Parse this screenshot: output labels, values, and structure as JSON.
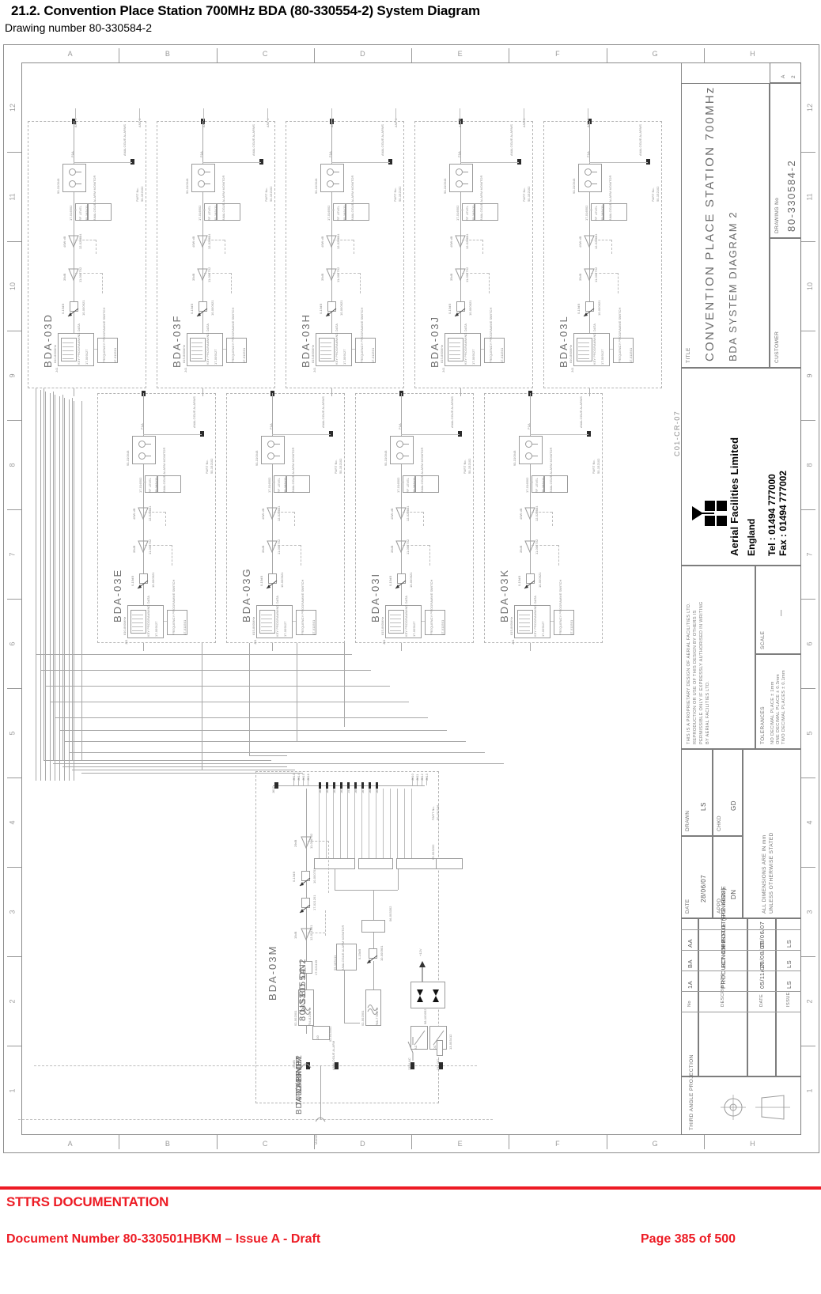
{
  "heading": {
    "title": "21.2. Convention Place Station 700MHz BDA (80-330554-2) System Diagram",
    "subtitle": "Drawing number 80-330584-2"
  },
  "footer": {
    "rule_color": "#ed1b24",
    "line1": "STTRS DOCUMENTATION",
    "line2": "Document Number 80-330501HBKM – Issue A - Draft",
    "line3": "Page 385 of 500"
  },
  "sheet": {
    "border_letters": [
      "A",
      "B",
      "C",
      "D",
      "E",
      "F",
      "G",
      "H"
    ],
    "border_numbers": [
      "12",
      "11",
      "10",
      "9",
      "8",
      "7",
      "6",
      "5",
      "4",
      "3",
      "2",
      "1"
    ],
    "sheet_ref": "C01-CR-07",
    "used_on_label": "USED ON",
    "used_on_value": "80-330554-2",
    "to_from_label": "TO/FROM",
    "to_from_value_1": "700/800MHz",
    "to_from_value_2": "BDA CABINET"
  },
  "titleblock": {
    "title_label": "TITLE",
    "title_line1": "CONVENTION PLACE STATION 700MHz",
    "title_line2": "BDA SYSTEM DIAGRAM 2",
    "drawing_no_label": "DRAWING No",
    "drawing_no": "80-330584-2",
    "customer_label": "CUSTOMER",
    "customer": "",
    "sheet_a": "A",
    "sheet_2": "2",
    "company_name": "Aerial Facilities Limited",
    "company_country": "England",
    "company_tel": "Tel : 01494 777000",
    "company_fax": "Fax : 01494 777002",
    "proprietary_notice": "THIS IS A PROPRIETARY DESIGN OF AERIAL FACILITIES LTD. REPRODUCTION OR USE OF THIS DESIGN BY OTHERS IS PERMISSIBLE ONLY IF EXPRESSLY AUTHORISED IN WRITING BY AERIAL FACILITIES LTD.",
    "scale_label": "SCALE",
    "scale_value": "—",
    "tolerances_label": "TOLERANCES",
    "tolerance_lines": [
      "NO DECIMAL PLACE ± 1mm",
      "ONE DECIMAL PLACE ± 0.3mm",
      "TWO DECIMAL PLACES ± 0.1mm"
    ],
    "dimensions_note": "ALL DIMENSIONS ARE IN mm UNLESS OTHERWISE STATED",
    "drawn_label": "DRAWN",
    "drawn_by": "LS",
    "date_label": "DATE",
    "drawn_date": "28/06/07",
    "chkd_label": "CHKD",
    "chkd_by": "GD",
    "appd_label": "APPD",
    "appd_by": "DN",
    "third_angle_label": "THIRD ANGLE PROJECTION",
    "revision_headers": {
      "no": "No",
      "description": "DESCRIPTION",
      "date": "DATE",
      "issue": "ISSUE"
    },
    "revisions": [
      {
        "no": "1A",
        "description": "PRODUCTION ISSUE (ECN4628)",
        "date": "05/11/07",
        "issue": "LS"
      },
      {
        "no": "BA",
        "description": "ECN4552",
        "date": "28/08/07",
        "issue": "LS"
      },
      {
        "no": "AA",
        "description": "PROTOTYPE ISSUE",
        "date": "28/06/07",
        "issue": "LS"
      }
    ]
  },
  "schematic": {
    "modules_row1": [
      "BDA-03D",
      "BDA-03F",
      "BDA-03H",
      "BDA-03J",
      "BDA-03L"
    ],
    "modules_row2": [
      "BDA-03E",
      "BDA-03G",
      "BDA-03I",
      "BDA-03K"
    ],
    "module_main": "BDA-03M",
    "antenna_ports_row1": [
      "ANT 1",
      "ANT 2",
      "ANT 3",
      "ANT 4",
      "ANT 5",
      "ANT 6",
      "ANT 7",
      "ANT 8",
      "ANT 9"
    ],
    "channel_module": {
      "analogue_alarms": "ANALOGUE ALARMS",
      "part_no_label": "PART No.",
      "part_no": "50-152102",
      "duplexer_pn": "93-310048",
      "rf_level_label": "RF LEVEL",
      "rf_level_pn": "17-016502",
      "alarm_monitor_label": "ANALOGUE ALARM MONITOR",
      "alarm_monitor_pn": "55-165411",
      "amp_40w": "40W dB",
      "amp_40w_pn": "12-020884",
      "amp_35db": "35dB",
      "amp_35db_pn": "11-006702",
      "atten_label": "0-15dB",
      "atten_pn": "10-000921",
      "filter_band": "810-860MHz",
      "filter_pn": "17-009127",
      "filter_sub": "KEY PROGRAMMING DATA",
      "fps_label": "FREQUENCY PROGRAMME SWITCH",
      "fps_pn": "17-011501",
      "pin_label": "P1A",
      "jack_label": "J41"
    },
    "main_module": {
      "name": "BDA-03M",
      "part_no_label": "PART No.",
      "part_no": "50-152106",
      "amp_29db": "29dB",
      "amp_29db_pn": "11-006702",
      "amp_15db": "15dB",
      "amp_15db_pn": "12-021901",
      "atten_a": "0-15dB",
      "atten_a_pn": "10-000701",
      "atten_b_pn": "17-021201",
      "atten_c": "0-15dB",
      "atten_c_pn": "10-000901",
      "agc_label": "AGC",
      "agc_pn": "17-021109",
      "filter1": "794-824MHz",
      "filter1_pn": "02-002001",
      "filter2": "766-776MHz",
      "filter2_pn": "02-002001",
      "splitter_pn": "05-003202",
      "combiner_pn": "06-003302",
      "alarm_monitor_label": "ANALOGUE ALARM MONITOR",
      "alarm_monitor_pn": "55-165411",
      "psu_pn": "98-100052",
      "psu_ac": "AC",
      "psu_dc": "DC",
      "psu_ref": "13-003412",
      "voltage_12v": "+12V",
      "atten_30_label": "-30",
      "atten_30_pn": "02-013401",
      "minus_50db": "-50dB",
      "analogue_alarm": "ANALOGUE ALARM",
      "ac_115v": "115V AC",
      "dc_24v": "24V DC",
      "j_ports_left": [
        "J613",
        "J614",
        "J615",
        "J616"
      ],
      "j_ports_mid": [
        "J61",
        "J64",
        "J63",
        "J62",
        "J51",
        "J66",
        "J67",
        "J68",
        "J69"
      ],
      "j_ports_right": [
        "J610",
        "J611",
        "J612",
        "J613"
      ],
      "j_input": "J617",
      "mains_label": "MAINS"
    }
  }
}
